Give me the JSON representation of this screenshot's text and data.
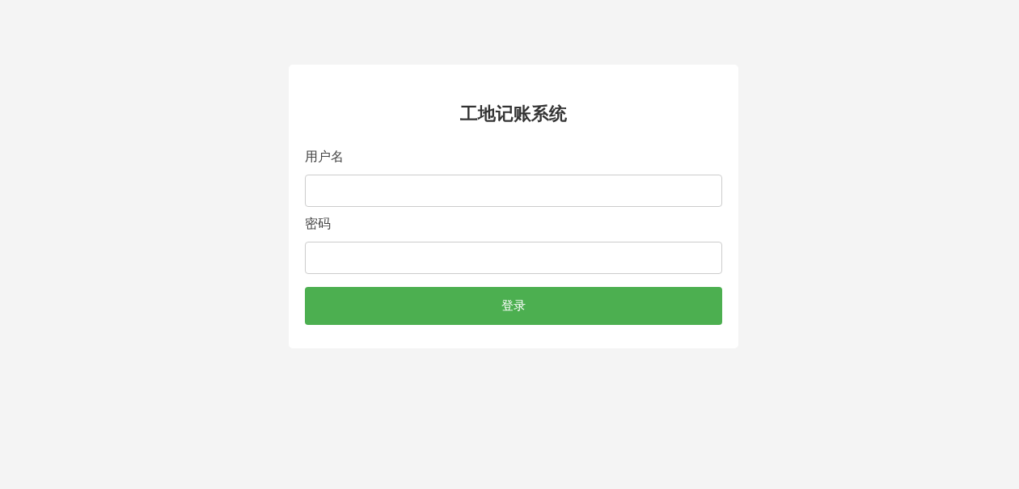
{
  "login": {
    "title": "工地记账系统",
    "fields": [
      {
        "label": "用户名"
      },
      {
        "label": "密码"
      }
    ],
    "button": {
      "label": "登录"
    }
  }
}
